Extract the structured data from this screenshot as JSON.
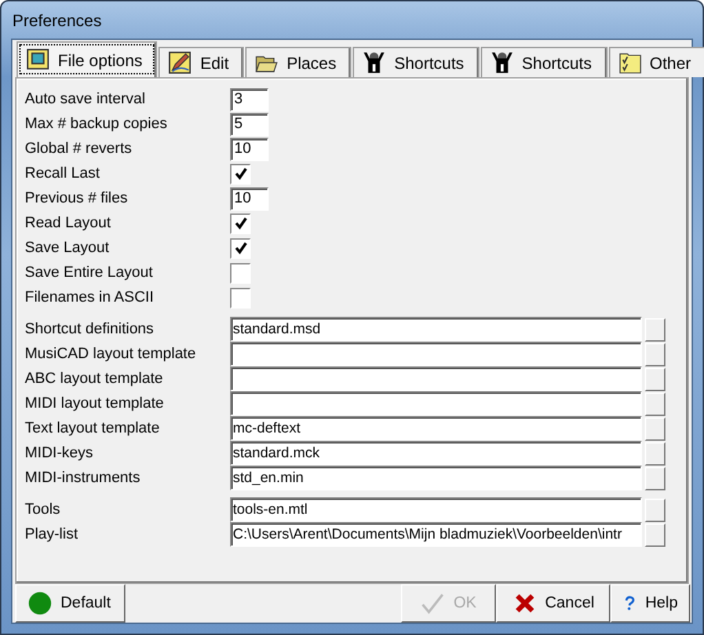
{
  "window": {
    "title": "Preferences"
  },
  "tabs": [
    {
      "label": "File options",
      "selected": true,
      "kind": "picture"
    },
    {
      "label": "Edit",
      "selected": false,
      "kind": "pencil"
    },
    {
      "label": "Places",
      "selected": false,
      "kind": "folder"
    },
    {
      "label": "Shortcuts",
      "selected": false,
      "kind": "figure1"
    },
    {
      "label": "Shortcuts",
      "selected": false,
      "kind": "figure2"
    },
    {
      "label": "Other",
      "selected": false,
      "kind": "checklist"
    }
  ],
  "options": [
    {
      "label": "Auto save interval",
      "kind": "number",
      "value": "3"
    },
    {
      "label": "Max # backup copies",
      "kind": "number",
      "value": "5"
    },
    {
      "label": "Global # reverts",
      "kind": "number",
      "value": "10"
    },
    {
      "label": "Recall Last",
      "kind": "check",
      "checked": true
    },
    {
      "label": "Previous # files",
      "kind": "number",
      "value": "10"
    },
    {
      "label": "Read Layout",
      "kind": "check",
      "checked": true
    },
    {
      "label": "Save Layout",
      "kind": "check",
      "checked": true
    },
    {
      "label": "Save Entire Layout",
      "kind": "check",
      "checked": false
    },
    {
      "label": "Filenames in ASCII",
      "kind": "check",
      "checked": false
    }
  ],
  "files": [
    {
      "label": "Shortcut definitions",
      "value": "standard.msd"
    },
    {
      "label": "MusiCAD layout template"
    },
    {
      "label": "ABC layout template"
    },
    {
      "label": "MIDI layout template"
    },
    {
      "label": "Text layout template",
      "value": "mc-deftext"
    },
    {
      "label": "MIDI-keys",
      "value": "standard.mck"
    },
    {
      "label": "MIDI-instruments",
      "value": "std_en.min"
    }
  ],
  "tools": [
    {
      "label": "Tools",
      "value": "tools-en.mtl"
    },
    {
      "label": "Play-list",
      "value": "C:\\Users\\Arent\\Documents\\Mijn bladmuziek\\Voorbeelden\\intr"
    }
  ],
  "buttons": [
    {
      "label": "Default",
      "kind": "default",
      "disabled": false
    },
    {
      "label": "OK",
      "kind": "ok",
      "disabled": true
    },
    {
      "label": "Cancel",
      "kind": "cancel",
      "disabled": false
    },
    {
      "label": "Help",
      "kind": "help",
      "disabled": false
    }
  ]
}
